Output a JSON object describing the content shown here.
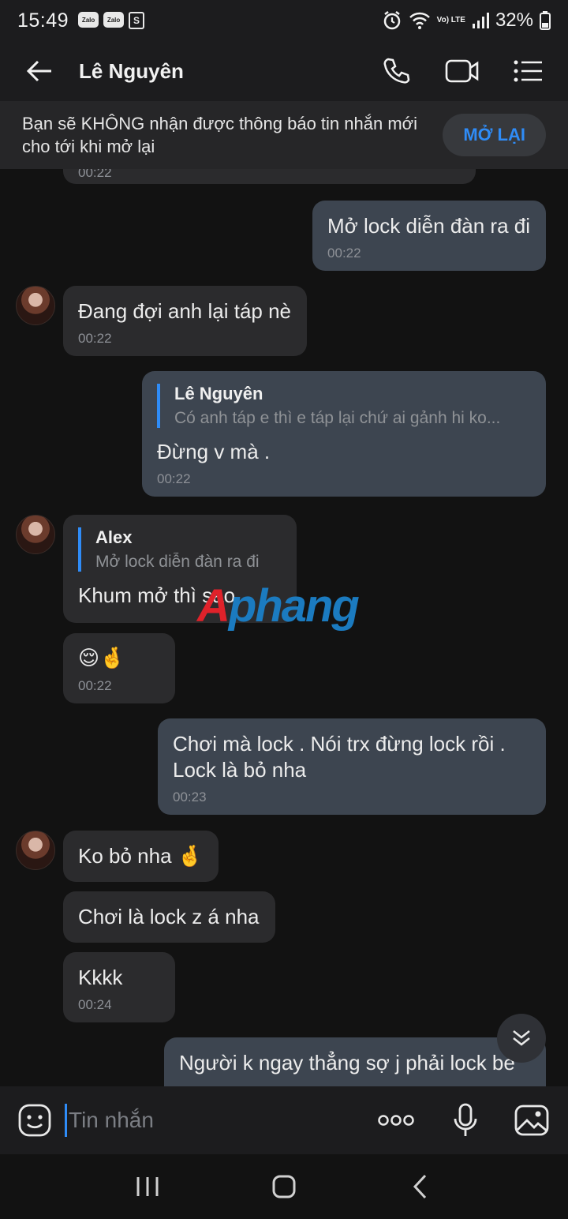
{
  "status_bar": {
    "time": "15:49",
    "apps": [
      "Zalo",
      "Zalo"
    ],
    "shop_label": "S",
    "network": "Vo) LTE",
    "battery": "32%"
  },
  "header": {
    "contact_name": "Lê Nguyên"
  },
  "notice": {
    "text": "Bạn sẽ KHÔNG nhận được thông báo tin nhắn mới cho tới khi mở lại",
    "button": "MỞ LẠI"
  },
  "messages": [
    {
      "dir": "in",
      "time": "00:22"
    },
    {
      "dir": "out",
      "text": "Mở lock diễn đàn ra đi",
      "time": "00:22"
    },
    {
      "dir": "in",
      "text": "Đang đợi anh lại táp nè",
      "time": "00:22"
    },
    {
      "dir": "out",
      "quote_author": "Lê Nguyên",
      "quote_text": "Có anh táp e thì e táp lại chứ ai gảnh hi ko...",
      "text": "Đừng v mà .",
      "time": "00:22"
    },
    {
      "dir": "in",
      "quote_author": "Alex",
      "quote_text": "Mở lock diễn đàn ra đi",
      "text": "Khum mở thì sao"
    },
    {
      "dir": "in",
      "text": "😌🤞",
      "time": "00:22"
    },
    {
      "dir": "out",
      "text": "Chơi mà lock . Nói trx đừng lock rồi . Lock là bỏ nha",
      "time": "00:23"
    },
    {
      "dir": "in",
      "text": "Ko bỏ nha 🤞"
    },
    {
      "dir": "in",
      "text": "Chơi là lock z á nha"
    },
    {
      "dir": "in",
      "text": "Kkkk",
      "time": "00:24"
    },
    {
      "dir": "out",
      "text": "Người k ngay thẳng sợ j phải lock be"
    }
  ],
  "watermark": {
    "first": "A",
    "rest": "phang"
  },
  "input": {
    "placeholder": "Tin nhắn"
  },
  "icons": {
    "back": "back-arrow-icon",
    "call": "phone-icon",
    "video": "video-camera-icon",
    "menu": "menu-list-icon",
    "sticker": "emoji-sticker-icon",
    "more": "more-dots-icon",
    "mic": "microphone-icon",
    "image": "image-icon",
    "scroll_down": "double-chevron-down-icon"
  },
  "colors": {
    "accent": "#2f8cf7",
    "incoming_bubble": "#2b2b2d",
    "outgoing_bubble": "#3d4550",
    "background": "#121212"
  }
}
